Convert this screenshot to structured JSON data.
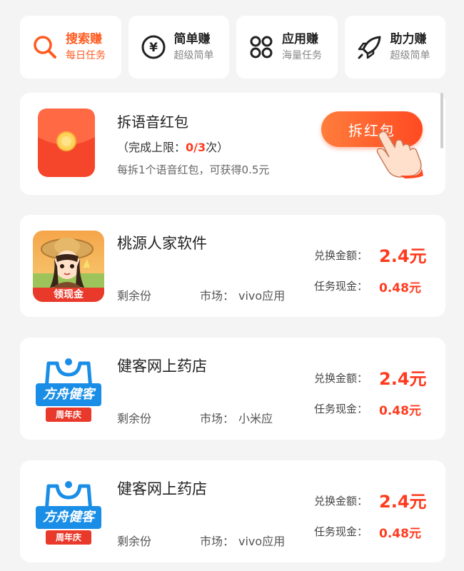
{
  "tabs": [
    {
      "title": "搜索赚",
      "subtitle": "每日任务",
      "icon": "search-icon",
      "active": true
    },
    {
      "title": "简单赚",
      "subtitle": "超级简单",
      "icon": "yen-icon",
      "active": false
    },
    {
      "title": "应用赚",
      "subtitle": "海量任务",
      "icon": "apps-icon",
      "active": false
    },
    {
      "title": "助力赚",
      "subtitle": "超级简单",
      "icon": "rocket-icon",
      "active": false
    }
  ],
  "red_packet": {
    "title": "拆语音红包",
    "limit_prefix": "（完成上限：",
    "limit_count": "0/3",
    "limit_suffix": "次）",
    "description": "每拆1个语音红包，可获得0.5元",
    "button_label": "拆红包"
  },
  "apps": [
    {
      "name": "桃源人家软件",
      "remaining_label": "剩余份",
      "market_label": "市场：",
      "market_value": "vivo应用",
      "exchange_label": "兑换金额：",
      "exchange_value": "2.4元",
      "cash_label": "任务现金：",
      "cash_value": "0.48元",
      "icon_badge": "领现金"
    },
    {
      "name": "健客网上药店",
      "remaining_label": "剩余份",
      "market_label": "市场：",
      "market_value": "小米应",
      "exchange_label": "兑换金额：",
      "exchange_value": "2.4元",
      "cash_label": "任务现金：",
      "cash_value": "0.48元",
      "icon_brand": "方舟健客",
      "icon_badge": "周年庆"
    },
    {
      "name": "健客网上药店",
      "remaining_label": "剩余份",
      "market_label": "市场：",
      "market_value": "vivo应用",
      "exchange_label": "兑换金额：",
      "exchange_value": "2.4元",
      "cash_label": "任务现金：",
      "cash_value": "0.48元",
      "icon_brand": "方舟健客",
      "icon_badge": "周年庆"
    }
  ],
  "colors": {
    "accent": "#ff5a1f",
    "price": "#ff3b1f",
    "background": "#f4f4f4"
  }
}
